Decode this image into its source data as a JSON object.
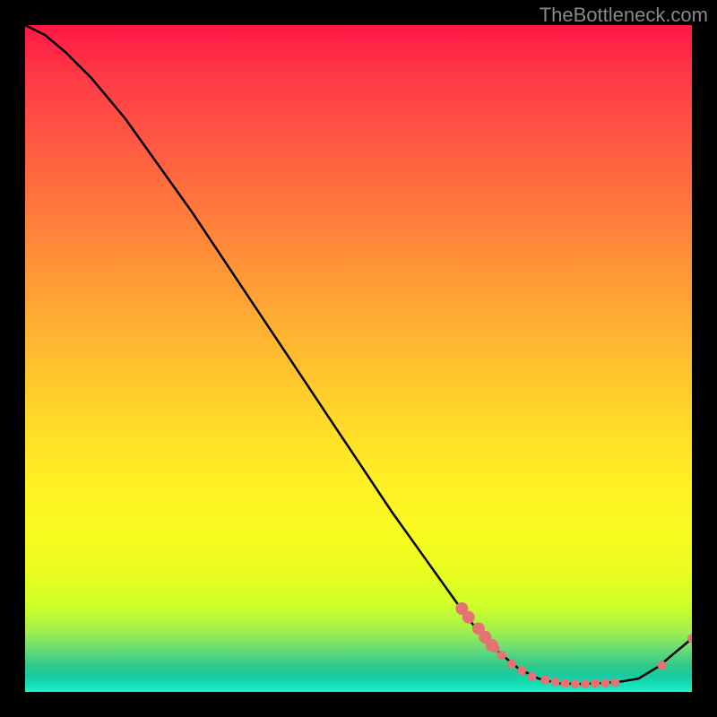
{
  "watermark": "TheBottleneck.com",
  "chart_data": {
    "type": "line",
    "title": "",
    "xlabel": "",
    "ylabel": "",
    "xlim": [
      0,
      100
    ],
    "ylim": [
      0,
      100
    ],
    "series": [
      {
        "name": "curve",
        "type": "line",
        "color": "#000000",
        "points": [
          {
            "x": 0,
            "y": 100
          },
          {
            "x": 3,
            "y": 98.5
          },
          {
            "x": 6,
            "y": 96
          },
          {
            "x": 10,
            "y": 92
          },
          {
            "x": 15,
            "y": 86
          },
          {
            "x": 20,
            "y": 79
          },
          {
            "x": 25,
            "y": 72
          },
          {
            "x": 30,
            "y": 64.5
          },
          {
            "x": 35,
            "y": 57
          },
          {
            "x": 40,
            "y": 49.5
          },
          {
            "x": 45,
            "y": 42
          },
          {
            "x": 50,
            "y": 34.5
          },
          {
            "x": 55,
            "y": 27
          },
          {
            "x": 60,
            "y": 20
          },
          {
            "x": 65,
            "y": 13
          },
          {
            "x": 68,
            "y": 9
          },
          {
            "x": 71,
            "y": 6
          },
          {
            "x": 74,
            "y": 3.5
          },
          {
            "x": 77,
            "y": 2
          },
          {
            "x": 80,
            "y": 1.3
          },
          {
            "x": 83,
            "y": 1.2
          },
          {
            "x": 86,
            "y": 1.3
          },
          {
            "x": 89,
            "y": 1.5
          },
          {
            "x": 92,
            "y": 2
          },
          {
            "x": 95,
            "y": 3.8
          },
          {
            "x": 97,
            "y": 5.5
          },
          {
            "x": 100,
            "y": 8
          }
        ]
      },
      {
        "name": "dots-upper",
        "type": "scatter",
        "color": "#e57373",
        "radius_large": true,
        "points": [
          {
            "x": 65.5,
            "y": 12.5
          },
          {
            "x": 66.5,
            "y": 11.2
          },
          {
            "x": 68,
            "y": 9.5
          },
          {
            "x": 69,
            "y": 8.2
          },
          {
            "x": 70,
            "y": 7
          }
        ]
      },
      {
        "name": "dots-lower",
        "type": "scatter",
        "color": "#e57373",
        "radius_large": false,
        "points": [
          {
            "x": 70.5,
            "y": 6.5
          },
          {
            "x": 71.5,
            "y": 5.5
          },
          {
            "x": 73,
            "y": 4.2
          },
          {
            "x": 74.5,
            "y": 3.2
          },
          {
            "x": 76,
            "y": 2.3
          },
          {
            "x": 78,
            "y": 1.8
          },
          {
            "x": 79.5,
            "y": 1.5
          },
          {
            "x": 81,
            "y": 1.3
          },
          {
            "x": 82.5,
            "y": 1.2
          },
          {
            "x": 84,
            "y": 1.2
          },
          {
            "x": 85.5,
            "y": 1.3
          },
          {
            "x": 87,
            "y": 1.3
          },
          {
            "x": 88.5,
            "y": 1.4
          }
        ]
      },
      {
        "name": "dots-right",
        "type": "scatter",
        "color": "#e57373",
        "radius_large": false,
        "points": [
          {
            "x": 95.5,
            "y": 4
          },
          {
            "x": 100,
            "y": 8
          }
        ]
      }
    ]
  }
}
